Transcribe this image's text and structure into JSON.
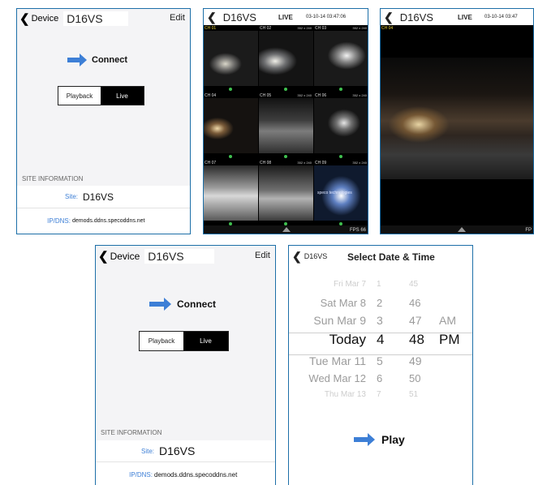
{
  "colors": {
    "accent": "#3d7fd6",
    "frame": "#1d6fa8",
    "live_dot": "#3fbf4f"
  },
  "device_screen": {
    "back_label": "Device",
    "title": "D16VS",
    "edit_label": "Edit",
    "connect_label": "Connect",
    "arrow_icon": "right-arrow-icon",
    "segments": {
      "playback": "Playback",
      "live": "Live",
      "selected": "live"
    },
    "site_header": "SITE INFORMATION",
    "site_key": "Site:",
    "site_value": "D16VS",
    "ipdns_key": "IP/DNS:",
    "ipdns_value": "demods.ddns.specoddns.net"
  },
  "live_grid": {
    "title": "D16VS",
    "mode": "LIVE",
    "timestamp": "03-10-14 03:47:06",
    "fps_label": "FPS 66",
    "cameras": [
      {
        "label": "CH 01",
        "res": ""
      },
      {
        "label": "CH 02",
        "res": "352 x 240"
      },
      {
        "label": "CH 03",
        "res": "352 x 240"
      },
      {
        "label": "CH 04",
        "res": ""
      },
      {
        "label": "CH 05",
        "res": "352 x 240"
      },
      {
        "label": "CH 06",
        "res": "352 x 240"
      },
      {
        "label": "CH 07",
        "res": ""
      },
      {
        "label": "CH 08",
        "res": "352 x 240"
      },
      {
        "label": "CH 09",
        "res": "352 x 240"
      }
    ],
    "watermark": "speco technologies"
  },
  "live_single": {
    "title": "D16VS",
    "mode": "LIVE",
    "timestamp": "03-10-14 03:47",
    "channel": "CH 04",
    "fps_label": "FP"
  },
  "date_picker": {
    "back_label": "D16VS",
    "title": "Select Date & Time",
    "rows": [
      {
        "date": "Fri Mar 7",
        "hour": "1",
        "minute": "45",
        "ampm": ""
      },
      {
        "date": "Sat Mar 8",
        "hour": "2",
        "minute": "46",
        "ampm": ""
      },
      {
        "date": "Sun Mar 9",
        "hour": "3",
        "minute": "47",
        "ampm": "AM"
      },
      {
        "date": "Today",
        "hour": "4",
        "minute": "48",
        "ampm": "PM"
      },
      {
        "date": "Tue Mar 11",
        "hour": "5",
        "minute": "49",
        "ampm": ""
      },
      {
        "date": "Wed Mar 12",
        "hour": "6",
        "minute": "50",
        "ampm": ""
      },
      {
        "date": "Thu Mar 13",
        "hour": "7",
        "minute": "51",
        "ampm": ""
      }
    ],
    "play_label": "Play"
  }
}
